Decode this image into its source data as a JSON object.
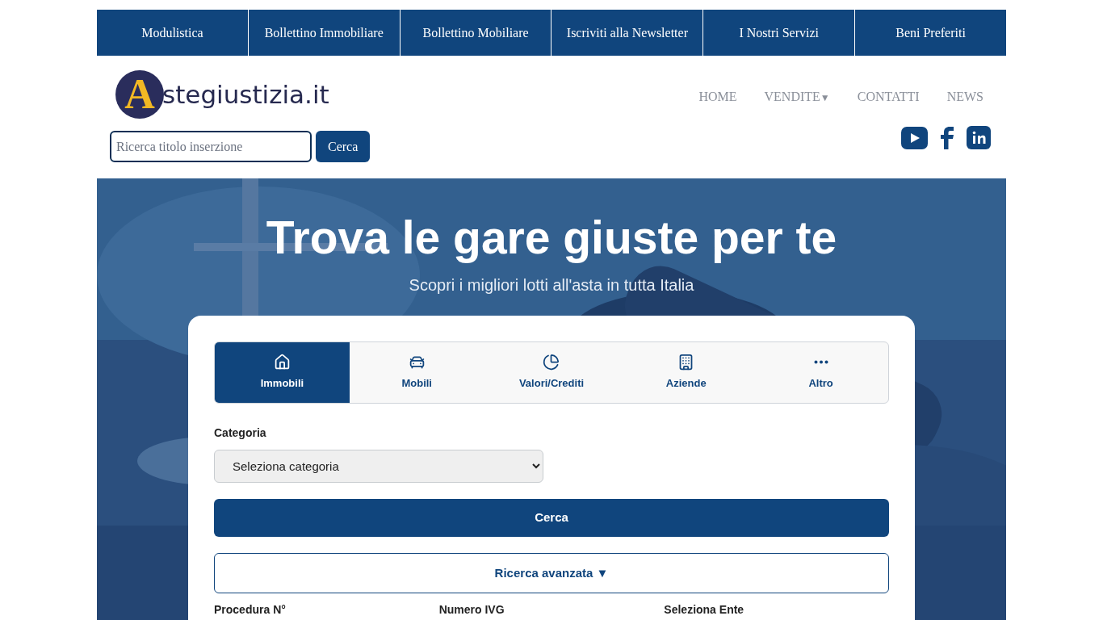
{
  "top_menu": [
    {
      "label": "Modulistica"
    },
    {
      "label": "Bollettino Immobiliare"
    },
    {
      "label": "Bollettino Mobiliare"
    },
    {
      "label": "Iscriviti alla Newsletter"
    },
    {
      "label": "I Nostri Servizi"
    },
    {
      "label": "Beni Preferiti"
    }
  ],
  "logo": {
    "initial": "A",
    "text": "stegiustizia.it"
  },
  "nav": [
    {
      "label": "HOME"
    },
    {
      "label": "VENDITE",
      "caret": "▼"
    },
    {
      "label": "CONTATTI"
    },
    {
      "label": "NEWS"
    }
  ],
  "search": {
    "placeholder": "Ricerca titolo inserzione",
    "button": "Cerca"
  },
  "hero": {
    "title": "Trova le gare giuste per te",
    "subtitle": "Scopri i migliori lotti all'asta in tutta Italia"
  },
  "tabs": [
    {
      "label": "Immobili",
      "selected": true
    },
    {
      "label": "Mobili",
      "selected": false
    },
    {
      "label": "Valori/Crediti",
      "selected": false
    },
    {
      "label": "Aziende",
      "selected": false
    },
    {
      "label": "Altro",
      "selected": false
    }
  ],
  "form": {
    "category_label": "Categoria",
    "category_value": "Seleziona categoria",
    "search_button": "Cerca",
    "advanced_button": "Ricerca avanzata ▼",
    "fields": [
      "Procedura N°",
      "Numero IVG",
      "Seleziona Ente"
    ]
  }
}
